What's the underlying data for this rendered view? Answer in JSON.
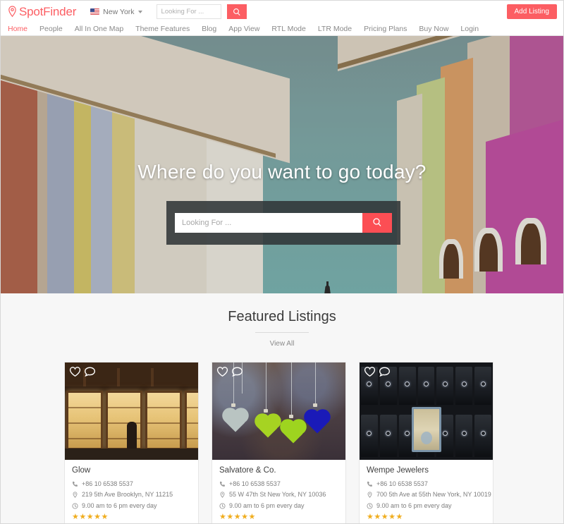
{
  "header": {
    "logo_text": "SpotFinder",
    "logo_icon": "map-pin-icon",
    "accent_color": "#fc5e63",
    "city_select": {
      "label": "New York",
      "flag_icon": "us-flag-icon",
      "chevron_icon": "chevron-down-icon"
    },
    "search": {
      "placeholder": "Looking For ...",
      "value": "",
      "button_icon": "search-icon"
    },
    "add_listing_label": "Add Listing"
  },
  "nav": {
    "items": [
      {
        "label": "Home",
        "active": true
      },
      {
        "label": "People",
        "active": false
      },
      {
        "label": "All In One Map",
        "active": false
      },
      {
        "label": "Theme Features",
        "active": false
      },
      {
        "label": "Blog",
        "active": false
      },
      {
        "label": "App View",
        "active": false
      },
      {
        "label": "RTL Mode",
        "active": false
      },
      {
        "label": "LTR Mode",
        "active": false
      },
      {
        "label": "Pricing Plans",
        "active": false
      },
      {
        "label": "Buy Now",
        "active": false
      },
      {
        "label": "Login",
        "active": false
      }
    ]
  },
  "hero": {
    "title": "Where do you want to go today?",
    "search": {
      "placeholder": "Looking For ...",
      "value": "",
      "button_icon": "search-icon"
    }
  },
  "featured": {
    "title": "Featured Listings",
    "view_all_label": "View All",
    "listings": [
      {
        "name": "Glow",
        "phone": "+86 10 6538 5537",
        "address": "219 5th Ave Brooklyn, NY 11215",
        "hours": "9.00 am to 6 pm every day",
        "rating": 5,
        "stars": "★★★★★",
        "favorite_icon": "heart-icon",
        "comment_icon": "speech-bubble-icon",
        "phone_icon": "phone-icon",
        "location_icon": "map-pin-icon",
        "clock_icon": "clock-icon",
        "image_alt": "jewelry-shop-window"
      },
      {
        "name": "Salvatore & Co.",
        "phone": "+86 10 6538 5537",
        "address": "55 W 47th St New York, NY 10036",
        "hours": "9.00 am to 6 pm every day",
        "rating": 5,
        "stars": "★★★★★",
        "favorite_icon": "heart-icon",
        "comment_icon": "speech-bubble-icon",
        "phone_icon": "phone-icon",
        "location_icon": "map-pin-icon",
        "clock_icon": "clock-icon",
        "image_alt": "glass-heart-pendants"
      },
      {
        "name": "Wempe Jewelers",
        "phone": "+86 10 6538 5537",
        "address": "700 5th Ave at 55th New York, NY 10019",
        "hours": "9.00 am to 6 pm every day",
        "rating": 5,
        "stars": "★★★★★",
        "favorite_icon": "heart-icon",
        "comment_icon": "speech-bubble-icon",
        "phone_icon": "phone-icon",
        "location_icon": "map-pin-icon",
        "clock_icon": "clock-icon",
        "image_alt": "ring-display-cases"
      }
    ]
  }
}
